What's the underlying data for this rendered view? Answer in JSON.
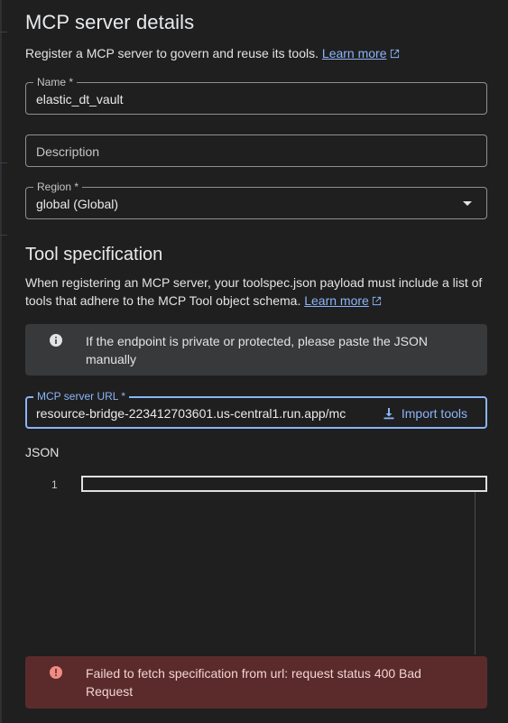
{
  "details": {
    "title": "MCP server details",
    "description": "Register a MCP server to govern and reuse its tools.",
    "learn_more": "Learn more"
  },
  "form": {
    "name": {
      "label": "Name *",
      "value": "elastic_dt_vault"
    },
    "description": {
      "placeholder": "Description"
    },
    "region": {
      "label": "Region *",
      "value": "global (Global)"
    }
  },
  "tool_spec": {
    "title": "Tool specification",
    "description": "When registering an MCP server, your toolspec.json payload must include a list of tools that adhere to the MCP Tool object schema.",
    "learn_more": "Learn more",
    "info_banner": "If the endpoint is private or protected, please paste the JSON manually",
    "url_field": {
      "label": "MCP server URL *",
      "value": "resource-bridge-223412703601.us-central1.run.app/mc"
    },
    "import_button": "Import tools",
    "json_label": "JSON",
    "editor_line_number": "1",
    "error_banner": "Failed to fetch specification from url: request status 400 Bad Request"
  },
  "colors": {
    "background": "#1f1f1f",
    "accent": "#8ab4f8",
    "error_bg": "#5b2b2b",
    "error_icon": "#f28b82",
    "info_bg": "#37393b"
  }
}
